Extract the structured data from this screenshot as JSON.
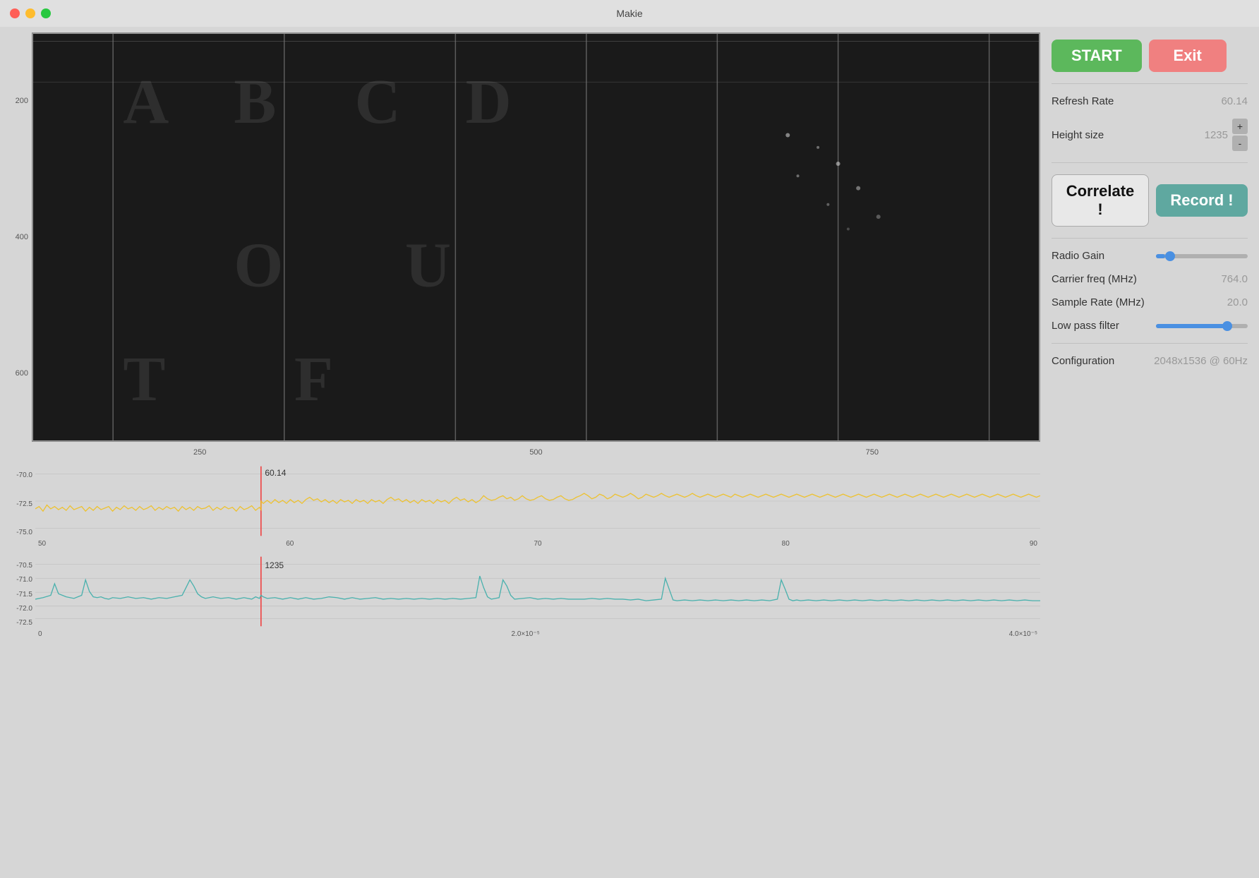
{
  "titlebar": {
    "title": "Makie"
  },
  "controls": {
    "start_label": "START",
    "exit_label": "Exit",
    "correlate_label": "Correlate !",
    "record_label": "Record !",
    "refresh_rate_label": "Refresh Rate",
    "refresh_rate_value": "60.14",
    "height_size_label": "Height size",
    "height_size_value": "1235",
    "plus_label": "+",
    "minus_label": "-",
    "radio_gain_label": "Radio Gain",
    "carrier_freq_label": "Carrier freq (MHz)",
    "carrier_freq_value": "764.0",
    "sample_rate_label": "Sample Rate (MHz)",
    "sample_rate_value": "20.0",
    "low_pass_label": "Low pass filter",
    "configuration_label": "Configuration",
    "configuration_value": "2048x1536 @ 60Hz"
  },
  "spectrogram": {
    "y_axis": [
      "200",
      "400",
      "600"
    ],
    "x_axis": [
      "250",
      "500",
      "750"
    ]
  },
  "chart1": {
    "y_axis": [
      "-70.0",
      "-72.5",
      "-75.0"
    ],
    "x_axis": [
      "50",
      "60",
      "70",
      "80",
      "90"
    ],
    "annotation_value": "60.14",
    "annotation_x_label": "60"
  },
  "chart2": {
    "y_axis": [
      "-70.5",
      "-71.0",
      "-71.5",
      "-72.0",
      "-72.5"
    ],
    "x_axis": [
      "0",
      "2.0×10⁻⁵",
      "4.0×10⁻⁵"
    ],
    "annotation_value": "1235",
    "annotation_x_label": ""
  }
}
